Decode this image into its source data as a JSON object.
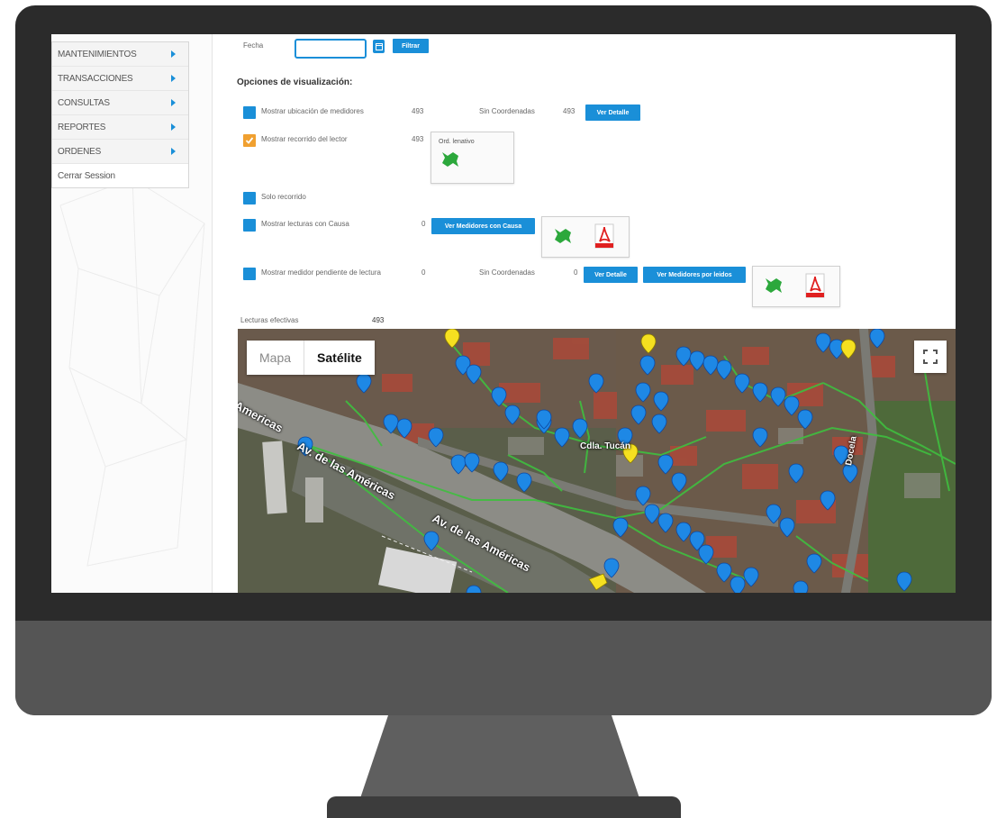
{
  "menu": {
    "items": [
      {
        "label": "MANTENIMIENTOS"
      },
      {
        "label": "TRANSACCIONES"
      },
      {
        "label": "CONSULTAS"
      },
      {
        "label": "REPORTES"
      },
      {
        "label": "ORDENES"
      }
    ],
    "logout": "Cerrar Session"
  },
  "filter": {
    "date_label": "Fecha",
    "date_value": "",
    "filter_button": "Filtrar"
  },
  "options": {
    "title": "Opciones de visualización:",
    "rows": [
      {
        "label": "Mostrar ubicación de medidores",
        "count": "493",
        "no_coords_label": "Sin Coordenadas",
        "no_coords_count": "493",
        "button": "Ver Detalle",
        "checked": false
      },
      {
        "label": "Mostrar recorrido del lector",
        "count": "493",
        "checked": true
      },
      {
        "label": "Solo recorrido",
        "checked": false
      },
      {
        "label": "Mostrar lecturas con Causa",
        "count": "0",
        "button": "Ver Medidores con Causa",
        "checked": false
      },
      {
        "label": "Mostrar medidor pendiente de lectura",
        "count": "0",
        "no_coords_label": "Sin Coordenadas",
        "no_coords_count": "0",
        "button": "Ver Detalle",
        "button2": "Ver Medidores por leidos",
        "checked": false
      }
    ],
    "kml_box_label": "Ord. lenativo",
    "effective_label": "Lecturas efectivas",
    "effective_count": "493"
  },
  "map": {
    "map_label": "Mapa",
    "satellite_label": "Satélite",
    "roads": [
      "Americas",
      "Av. de las Américas",
      "Av. de las Américas",
      "Cdla. Tucán",
      "Docela"
    ]
  },
  "colors": {
    "accent": "#1a8fd8",
    "checked": "#f0a030",
    "marker_blue": "#1e88e5",
    "marker_yellow": "#f5e020",
    "route_green": "#3fbf3f"
  },
  "icons": {
    "kml": "green-map-icon",
    "pdf": "pdf-icon",
    "calendar": "calendar-icon",
    "fullscreen": "fullscreen-icon"
  }
}
